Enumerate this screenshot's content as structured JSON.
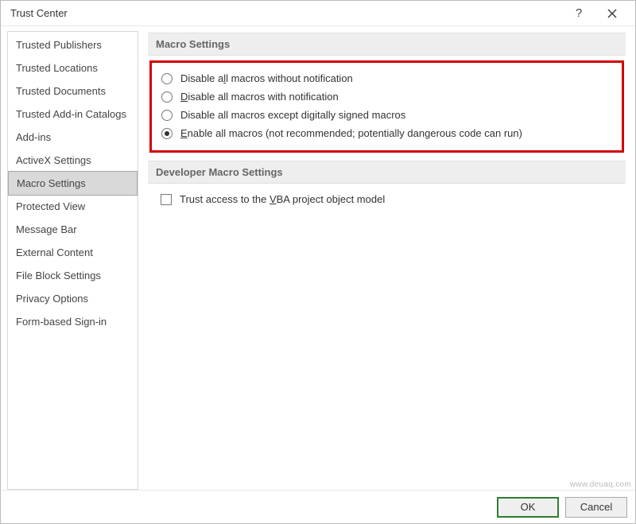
{
  "window": {
    "title": "Trust Center",
    "help_glyph": "?"
  },
  "sidebar": {
    "items": [
      {
        "label": "Trusted Publishers"
      },
      {
        "label": "Trusted Locations"
      },
      {
        "label": "Trusted Documents"
      },
      {
        "label": "Trusted Add-in Catalogs"
      },
      {
        "label": "Add-ins"
      },
      {
        "label": "ActiveX Settings"
      },
      {
        "label": "Macro Settings",
        "selected": true
      },
      {
        "label": "Protected View"
      },
      {
        "label": "Message Bar"
      },
      {
        "label": "External Content"
      },
      {
        "label": "File Block Settings"
      },
      {
        "label": "Privacy Options"
      },
      {
        "label": "Form-based Sign-in"
      }
    ]
  },
  "sections": {
    "macro_header": "Macro Settings",
    "developer_header": "Developer Macro Settings"
  },
  "macro_options": {
    "opt0_pre": "Disable a",
    "opt0_u": "l",
    "opt0_post": "l macros without notification",
    "opt1_pre": "",
    "opt1_u": "D",
    "opt1_post": "isable all macros with notification",
    "opt2_pre": "Disable all macros except di",
    "opt2_u": "g",
    "opt2_post": "itally signed macros",
    "opt3_pre": "",
    "opt3_u": "E",
    "opt3_post": "nable all macros (not recommended; potentially dangerous code can run)"
  },
  "developer": {
    "trust_pre": "Trust access to the ",
    "trust_u": "V",
    "trust_post": "BA project object model"
  },
  "buttons": {
    "ok": "OK",
    "cancel": "Cancel"
  },
  "watermark": "www.deuaq.com"
}
